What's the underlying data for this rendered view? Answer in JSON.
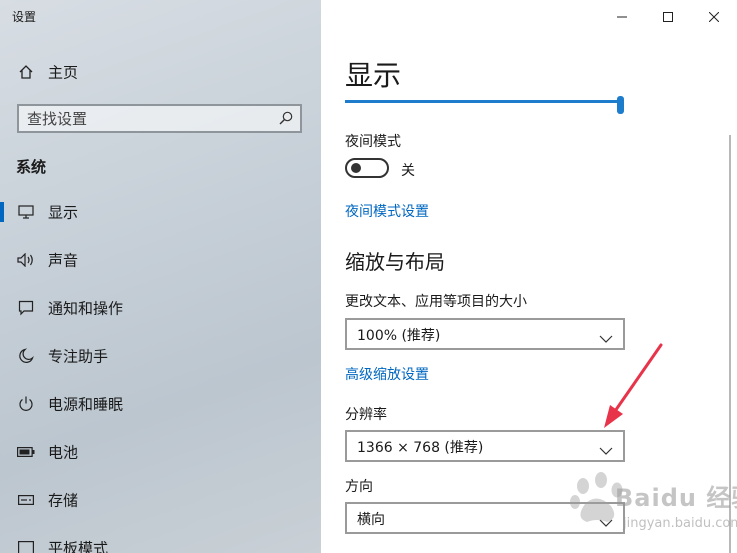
{
  "window": {
    "app_title": "设置",
    "caption_buttons": {
      "minimize_icon": "minimize-icon",
      "maximize_icon": "maximize-icon",
      "close_icon": "close-icon"
    }
  },
  "sidebar": {
    "home_label": "主页",
    "search_placeholder": "查找设置",
    "section_label": "系统",
    "items": [
      {
        "label": "显示",
        "icon": "monitor-icon",
        "active": true
      },
      {
        "label": "声音",
        "icon": "speaker-icon"
      },
      {
        "label": "通知和操作",
        "icon": "notification-icon"
      },
      {
        "label": "专注助手",
        "icon": "moon-icon"
      },
      {
        "label": "电源和睡眠",
        "icon": "power-icon"
      },
      {
        "label": "电池",
        "icon": "battery-icon"
      },
      {
        "label": "存储",
        "icon": "storage-icon"
      },
      {
        "label": "平板模式",
        "icon": "tablet-icon"
      }
    ]
  },
  "main": {
    "title": "显示",
    "night_mode": {
      "label": "夜间模式",
      "toggle_state": "关",
      "settings_link": "夜间模式设置"
    },
    "scale_section": {
      "heading": "缩放与布局",
      "scale_label": "更改文本、应用等项目的大小",
      "scale_value": "100% (推荐)",
      "advanced_link": "高级缩放设置",
      "resolution_label": "分辨率",
      "resolution_value": "1366 × 768 (推荐)",
      "orientation_label": "方向",
      "orientation_value": "横向"
    }
  },
  "watermark": {
    "brand": "Baidu 经验",
    "url": "jingyan.baidu.com"
  },
  "colors": {
    "accent": "#0067c0",
    "arrow": "#e8344a",
    "slider": "#1e7ccc"
  }
}
